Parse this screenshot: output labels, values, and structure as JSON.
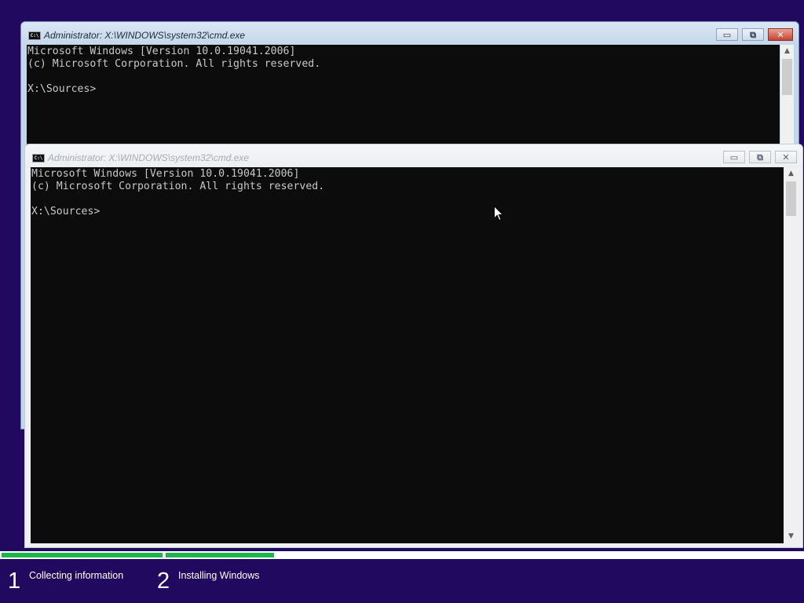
{
  "background_color": "#20095e",
  "windows": [
    {
      "title": "Administrator: X:\\WINDOWS\\system32\\cmd.exe",
      "icon_glyph": "C:\\",
      "icon": "cmd-icon",
      "state": "inactive-behind",
      "controls": {
        "minimize": "▭",
        "restore": "⧉",
        "close": "✕"
      },
      "lines": [
        "Microsoft Windows [Version 10.0.19041.2006]",
        "(c) Microsoft Corporation. All rights reserved.",
        "",
        "X:\\Sources>"
      ]
    },
    {
      "title": "Administrator: X:\\WINDOWS\\system32\\cmd.exe",
      "icon_glyph": "C:\\",
      "icon": "cmd-icon",
      "state": "front",
      "controls": {
        "minimize": "▭",
        "restore": "⧉",
        "close": "✕"
      },
      "lines": [
        "Microsoft Windows [Version 10.0.19041.2006]",
        "(c) Microsoft Corporation. All rights reserved.",
        "",
        "X:\\Sources>"
      ]
    }
  ],
  "scrollbar": {
    "up_arrow": "▲",
    "down_arrow": "▼"
  },
  "setup": {
    "progress": {
      "step1_fill": 1.0,
      "step2_fill": 0.17,
      "fill_color": "#1fb34c"
    },
    "steps": [
      {
        "number": "1",
        "label": "Collecting information"
      },
      {
        "number": "2",
        "label": "Installing Windows"
      }
    ]
  }
}
